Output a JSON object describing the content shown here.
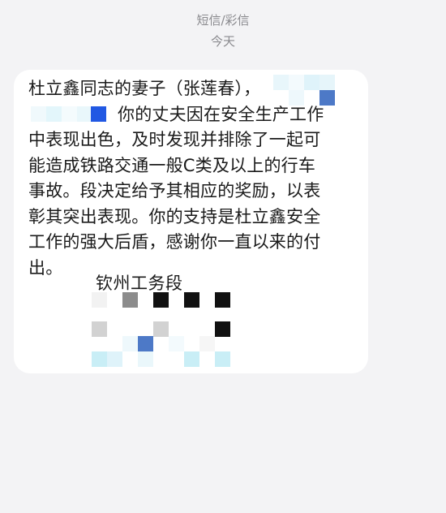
{
  "conversation": {
    "type_label": "短信/彩信",
    "date_label": "今天"
  },
  "message": {
    "lines": [
      "杜立鑫同志的妻子（张莲春），",
      "你的丈夫因在安全生产工作",
      "中表现出色，及时发现并排除了一起可",
      "能造成铁路交通一般C类及以上的行车",
      "事故。段决定给予其相应的奖励，以表",
      "彰其突出表现。你的支持是杜立鑫安全",
      "工作的强大后盾，感谢你一直以来的付",
      "出。"
    ],
    "sender": "钦州工务段"
  },
  "mosaic_colors": {
    "light_cyan": "#e3f6fb",
    "pale_blue": "#d6eef8",
    "medium_blue": "#4d79c7",
    "bright_blue": "#2158e3",
    "gray": "#8c8c8c",
    "light_gray": "#d2d2d2",
    "black": "#111111",
    "cyan": "#c9eef6"
  }
}
